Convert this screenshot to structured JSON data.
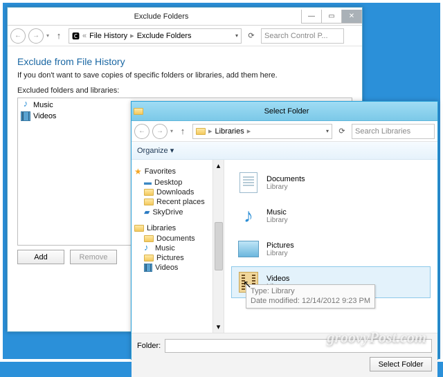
{
  "w1": {
    "title": "Exclude Folders",
    "crumbs": [
      "File History",
      "Exclude Folders"
    ],
    "search_ph": "Search Control P...",
    "heading": "Exclude from File History",
    "desc": "If you don't want to save copies of specific folders or libraries, add them here.",
    "list_label": "Excluded folders and libraries:",
    "items": [
      "Music",
      "Videos"
    ],
    "add": "Add",
    "remove": "Remove"
  },
  "w2": {
    "title": "Select Folder",
    "crumbs": [
      "Libraries"
    ],
    "search_ph": "Search Libraries",
    "organize": "Organize ▾",
    "nav": {
      "fav_hdr": "Favorites",
      "fav": [
        "Desktop",
        "Downloads",
        "Recent places",
        "SkyDrive"
      ],
      "lib_hdr": "Libraries",
      "lib": [
        "Documents",
        "Music",
        "Pictures",
        "Videos"
      ]
    },
    "tiles": [
      {
        "name": "Documents",
        "sub": "Library"
      },
      {
        "name": "Music",
        "sub": "Library"
      },
      {
        "name": "Pictures",
        "sub": "Library"
      },
      {
        "name": "Videos",
        "sub": "Library"
      }
    ],
    "tooltip": {
      "l1": "Type: Library",
      "l2": "Date modified: 12/14/2012 9:23 PM"
    },
    "folder_lbl": "Folder:",
    "select_btn": "Select Folder"
  },
  "watermark": "groovyPost.com"
}
